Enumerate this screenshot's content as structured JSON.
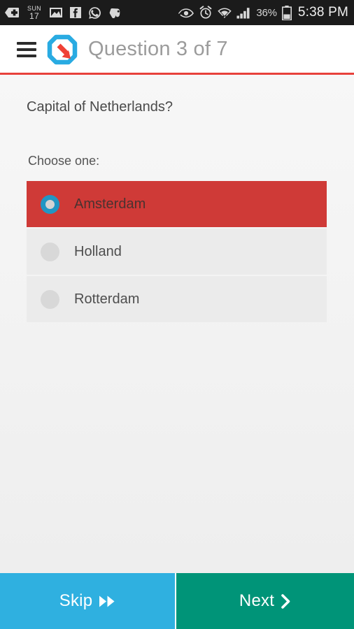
{
  "statusbar": {
    "left_icons": [
      {
        "name": "add-tag-icon",
        "label": ""
      },
      {
        "name": "calendar-icon",
        "weekday": "SUN",
        "day": "17"
      },
      {
        "name": "gallery-image-icon",
        "label": ""
      },
      {
        "name": "facebook-icon",
        "label": "f"
      },
      {
        "name": "whatsapp-icon",
        "label": ""
      },
      {
        "name": "evernote-icon",
        "label": ""
      }
    ],
    "right_icons": [
      {
        "name": "smart-stay-eye-icon",
        "label": ""
      },
      {
        "name": "alarm-clock-icon",
        "label": ""
      },
      {
        "name": "wifi-transfer-icon",
        "label": ""
      },
      {
        "name": "cellular-signal-icon",
        "label": ""
      }
    ],
    "battery_percent": "36%",
    "battery_icon": "battery-icon",
    "clock": "5:38 PM"
  },
  "appbar": {
    "menu_icon": "hamburger-menu-icon",
    "logo_icon": "app-logo-icon",
    "title": "Question 3 of 7",
    "accent_color": "#e8413c",
    "logo_blue": "#29abe2",
    "logo_red": "#ef4136"
  },
  "main": {
    "question": "Capital of Netherlands?",
    "choose_label": "Choose one:",
    "selected_index": 0,
    "selected_row_color": "#cf3a37",
    "unselected_row_color": "#ebebeb",
    "radio_selected_color": "#2196c4",
    "options": [
      {
        "label": "Amsterdam",
        "selected": true
      },
      {
        "label": "Holland",
        "selected": false
      },
      {
        "label": "Rotterdam",
        "selected": false
      }
    ]
  },
  "footer": {
    "skip": {
      "label": "Skip",
      "glyph": "fast-forward-icon",
      "color": "#2fb0e0"
    },
    "next": {
      "label": "Next",
      "glyph": "chevron-right-icon",
      "color": "#009478"
    }
  }
}
